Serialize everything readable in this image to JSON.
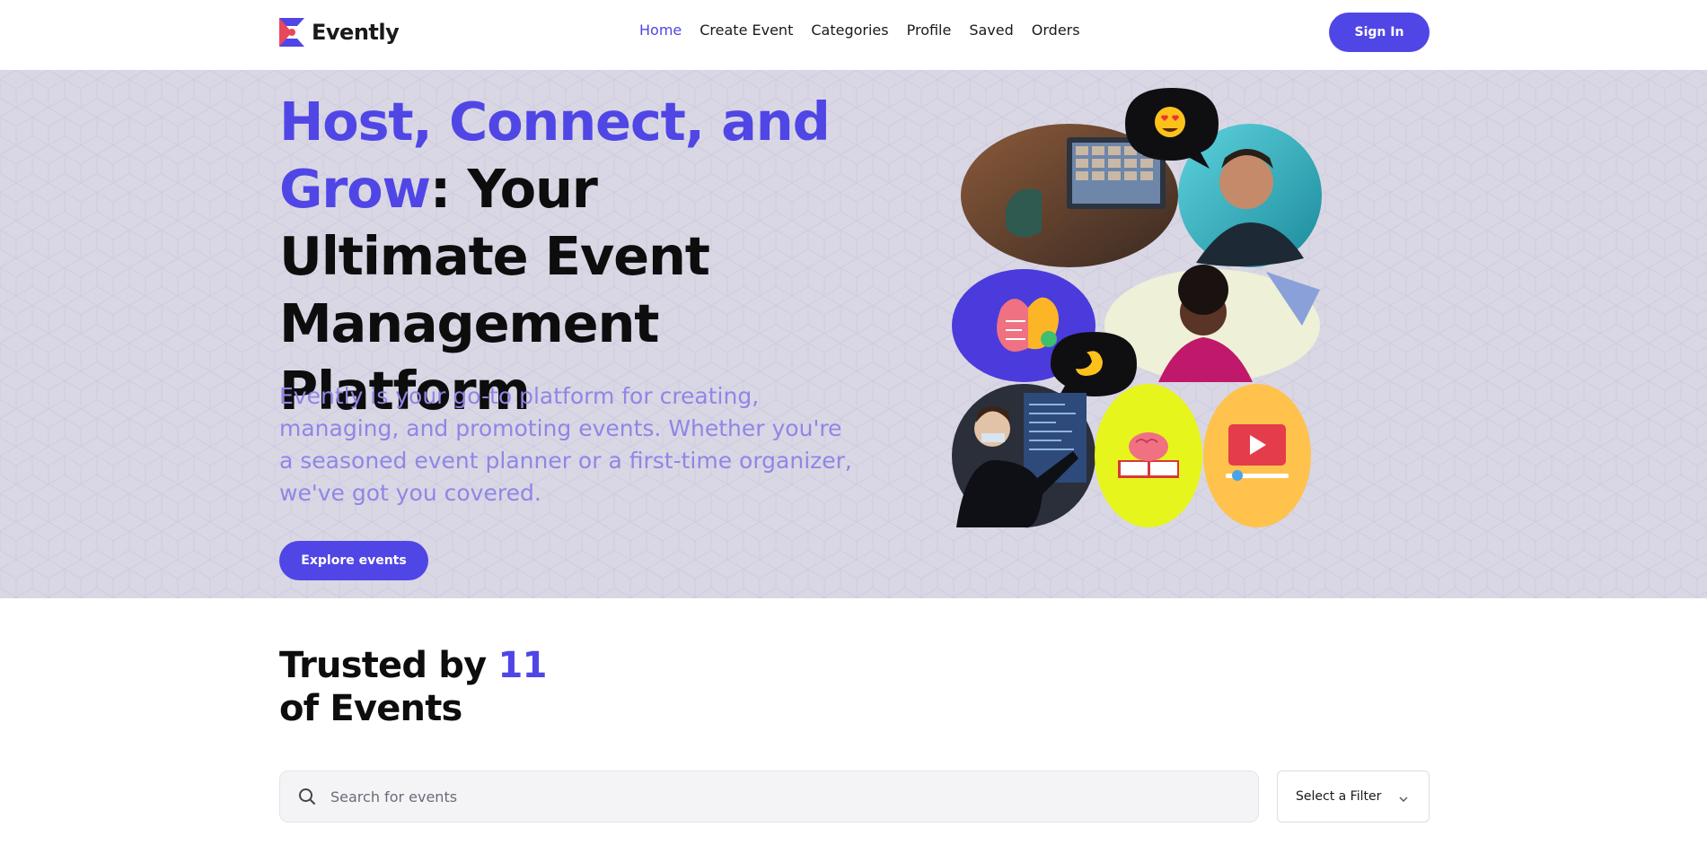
{
  "brand": {
    "name": "Evently",
    "accent": "#5046e5",
    "logo_color_a": "#e8485c",
    "logo_color_b": "#5046e5"
  },
  "nav": {
    "links": [
      {
        "label": "Home",
        "active": true
      },
      {
        "label": "Create Event",
        "active": false
      },
      {
        "label": "Categories",
        "active": false
      },
      {
        "label": "Profile",
        "active": false
      },
      {
        "label": "Saved",
        "active": false
      },
      {
        "label": "Orders",
        "active": false
      }
    ],
    "signin_label": "Sign In"
  },
  "hero": {
    "title_accent": "Host, Connect, and Grow",
    "title_rest": ": Your Ultimate Event Management Platform",
    "description": "Evently is your go-to platform for creating, managing, and promoting events. Whether you're a seasoned event planner or a first-time organizer, we've got you covered.",
    "cta_label": "Explore events",
    "background": "#d9d7e4",
    "collage_icons": [
      "heart-eyes-emoji-icon",
      "pinching-hand-emoji-icon",
      "brain-gear-icon",
      "brain-book-icon",
      "video-play-icon"
    ]
  },
  "trusted": {
    "prefix": "Trusted by ",
    "count": "11",
    "suffix": "of Events"
  },
  "search": {
    "placeholder": "Search for events",
    "value": ""
  },
  "filter": {
    "label": "Select a Filter"
  }
}
